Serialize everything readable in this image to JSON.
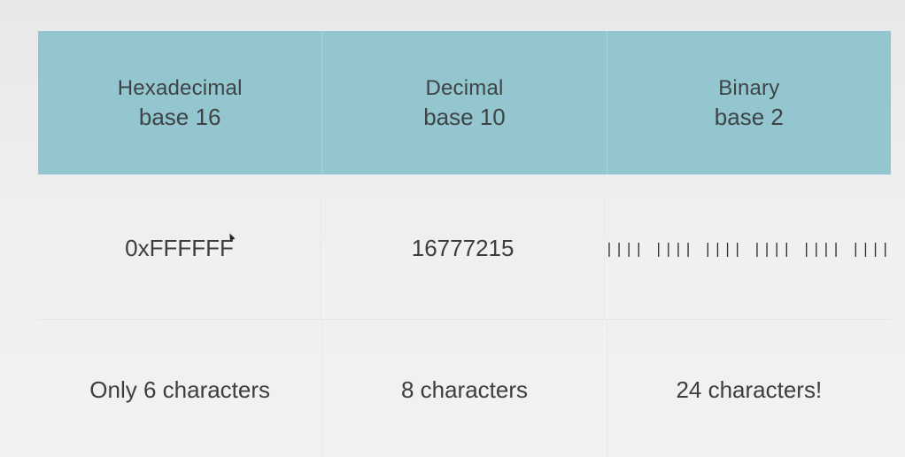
{
  "table": {
    "headers": [
      {
        "title": "Hexadecimal",
        "base": "base 16"
      },
      {
        "title": "Decimal",
        "base": "base 10"
      },
      {
        "title": "Binary",
        "base": "base 2"
      }
    ],
    "rows": [
      [
        "0xFFFFFF",
        "16777215",
        "|||| |||| |||| |||| |||| ||||"
      ],
      [
        "Only 6 characters",
        "8 characters",
        "24 characters!"
      ]
    ]
  },
  "colors": {
    "header_bg": "#93c6cf",
    "background": "#eeeff0",
    "text": "#3d3d3f"
  }
}
